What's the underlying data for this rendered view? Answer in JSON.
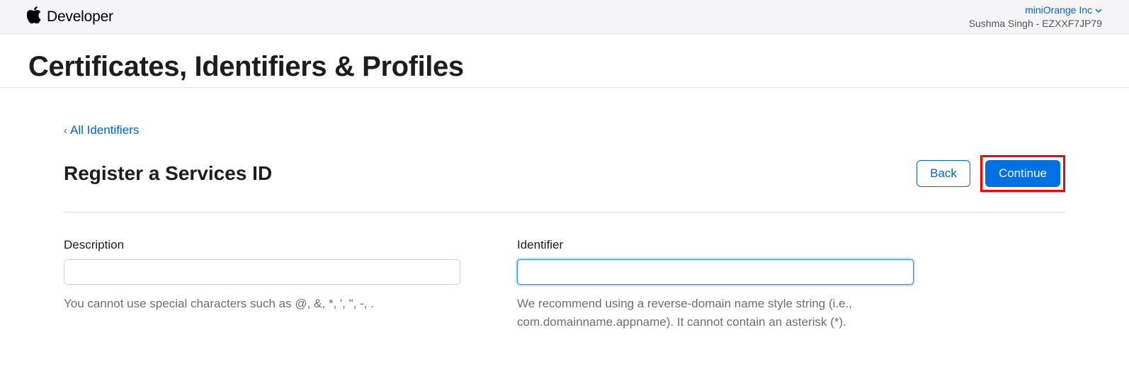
{
  "topbar": {
    "brand": "Developer",
    "team_name": "miniOrange Inc",
    "user_line": "Sushma Singh - EZXXF7JP79"
  },
  "page_title": "Certificates, Identifiers & Profiles",
  "back_link": "All Identifiers",
  "section_title": "Register a Services ID",
  "buttons": {
    "back": "Back",
    "continue": "Continue"
  },
  "form": {
    "description": {
      "label": "Description",
      "value": "",
      "helper": "You cannot use special characters such as @, &, *, ', \", -, ."
    },
    "identifier": {
      "label": "Identifier",
      "value": "",
      "helper": "We recommend using a reverse-domain name style string (i.e., com.domainname.appname). It cannot contain an asterisk (*)."
    }
  }
}
